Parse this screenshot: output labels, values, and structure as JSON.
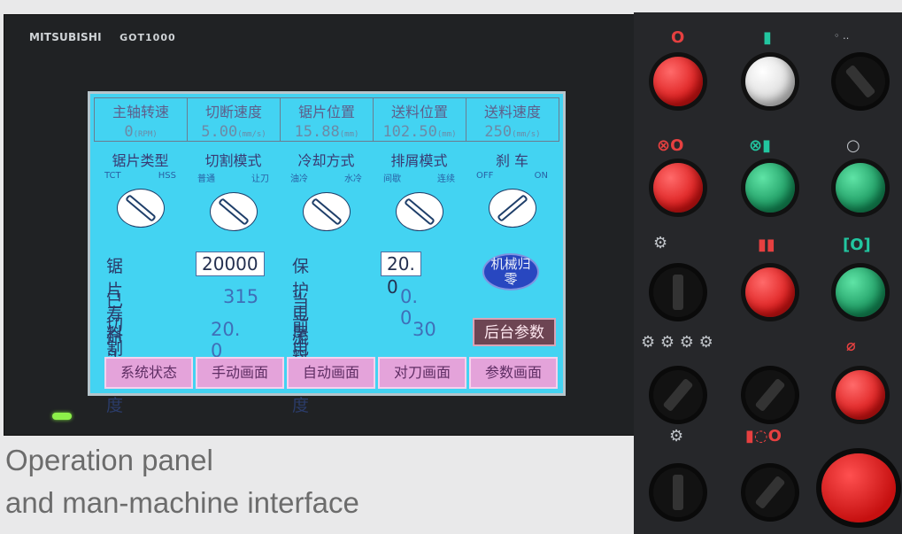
{
  "hmi": {
    "brand": "MITSUBISHI",
    "model": "GOT1000",
    "headers": [
      {
        "label": "主轴转速",
        "value": "0",
        "unit": "(RPM)"
      },
      {
        "label": "切断速度",
        "value": "5.00",
        "unit": "(mm/s)"
      },
      {
        "label": "锯片位置",
        "value": "15.88",
        "unit": "(mm)"
      },
      {
        "label": "送料位置",
        "value": "102.50",
        "unit": "(mm)"
      },
      {
        "label": "送料速度",
        "value": "250",
        "unit": "(mm/s)"
      }
    ],
    "modes": [
      {
        "title": "锯片类型",
        "opt_left": "TCT",
        "opt_right": "HSS"
      },
      {
        "title": "切割模式",
        "opt_left": "普通",
        "opt_right": "让刀"
      },
      {
        "title": "冷却方式",
        "opt_left": "油冷",
        "opt_right": "水冷"
      },
      {
        "title": "排屑模式",
        "opt_left": "间歇",
        "opt_right": "连续"
      },
      {
        "title": "刹 车",
        "opt_left": "OFF",
        "opt_right": "ON"
      }
    ],
    "blade_life_label": "锯片寿命",
    "blade_life_value": "20000",
    "protect_current_label": "保护电流",
    "protect_current_value": "20. 0",
    "cut_count_label": "已切割量",
    "cut_count_value": "315",
    "current_label": "当前电流",
    "current_value": "0. 0",
    "head_length_label": "料头长度",
    "head_length_value": "20. 0",
    "tail_length_label": "尾料长度",
    "tail_length_value": "30",
    "home_button": "机械归零",
    "backend_button": "后台参数",
    "nav": [
      "系统状态",
      "手动画面",
      "自动画面",
      "对刀画面",
      "参数画面"
    ]
  },
  "caption": {
    "line1": "Operation panel",
    "line2": "and man-machine interface"
  },
  "colors": {
    "screen": "#43d3f2",
    "nav_button": "#e4a3da",
    "panel": "#26272a",
    "red_button": "#d81414",
    "green_button": "#149059"
  },
  "panel_icons": [
    "power-off-icon",
    "power-on-icon",
    "selector-icon",
    "spindle-stop-icon",
    "spindle-start-icon",
    "blank-icon",
    "clamp-icon",
    "pause-icon",
    "cycle-start-icon",
    "feed-icons",
    "emergency-icon",
    "hydraulic-icon",
    "coolant-icon"
  ]
}
